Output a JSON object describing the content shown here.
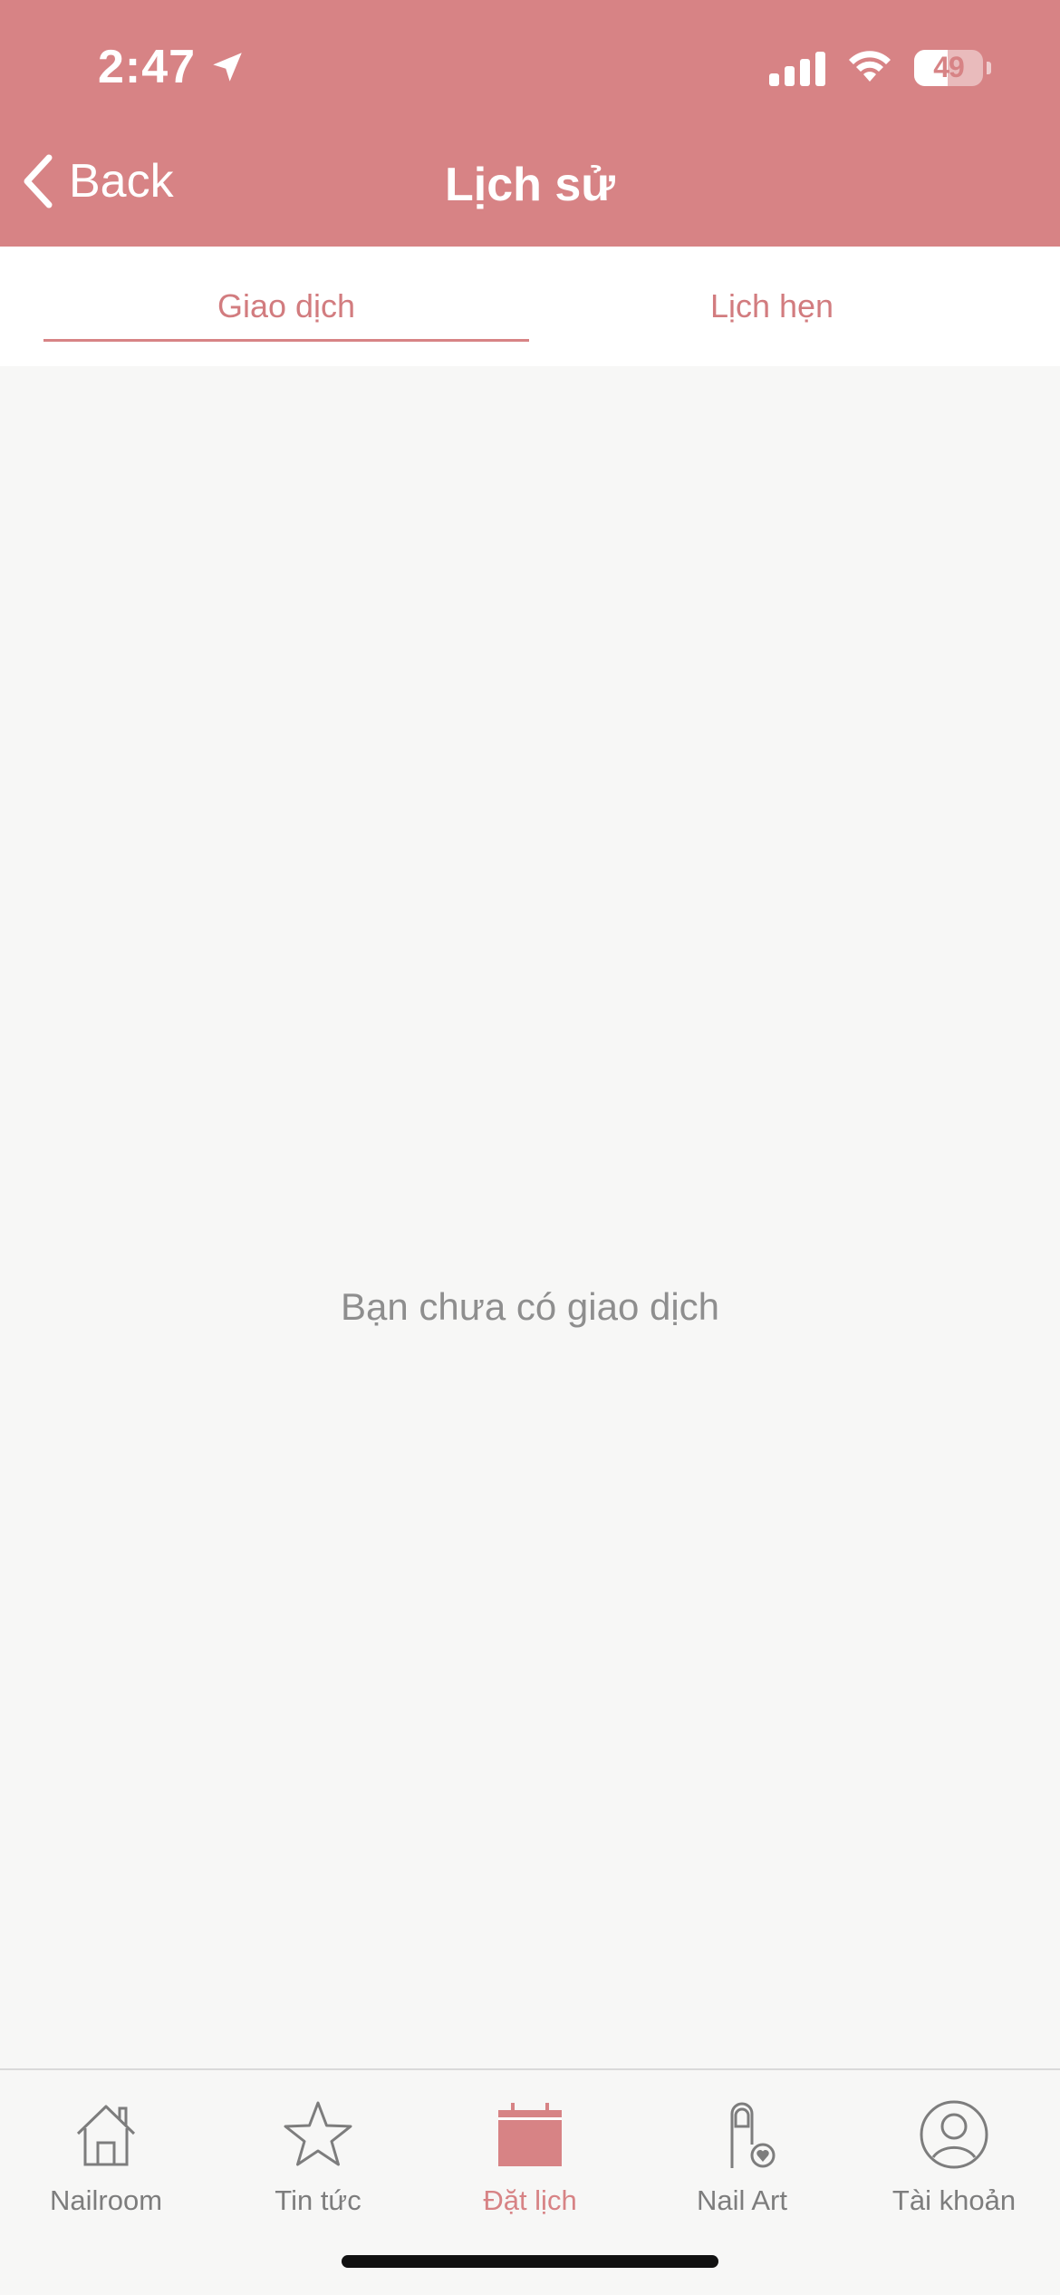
{
  "status_bar": {
    "time": "2:47",
    "battery": "49"
  },
  "nav": {
    "back_label": "Back",
    "title": "Lịch sử"
  },
  "tabs": [
    {
      "label": "Giao dịch",
      "active": true
    },
    {
      "label": "Lịch hẹn",
      "active": false
    }
  ],
  "content": {
    "empty_message": "Bạn chưa có giao dịch"
  },
  "tab_bar": {
    "items": [
      {
        "label": "Nailroom",
        "icon": "home-icon",
        "active": false
      },
      {
        "label": "Tin tức",
        "icon": "star-icon",
        "active": false
      },
      {
        "label": "Đặt lịch",
        "icon": "calendar-icon",
        "active": true
      },
      {
        "label": "Nail Art",
        "icon": "nail-icon",
        "active": false
      },
      {
        "label": "Tài khoản",
        "icon": "user-icon",
        "active": false
      }
    ]
  },
  "colors": {
    "accent": "#d78385",
    "inactive": "#7d7d7d",
    "background": "#f7f7f6"
  }
}
